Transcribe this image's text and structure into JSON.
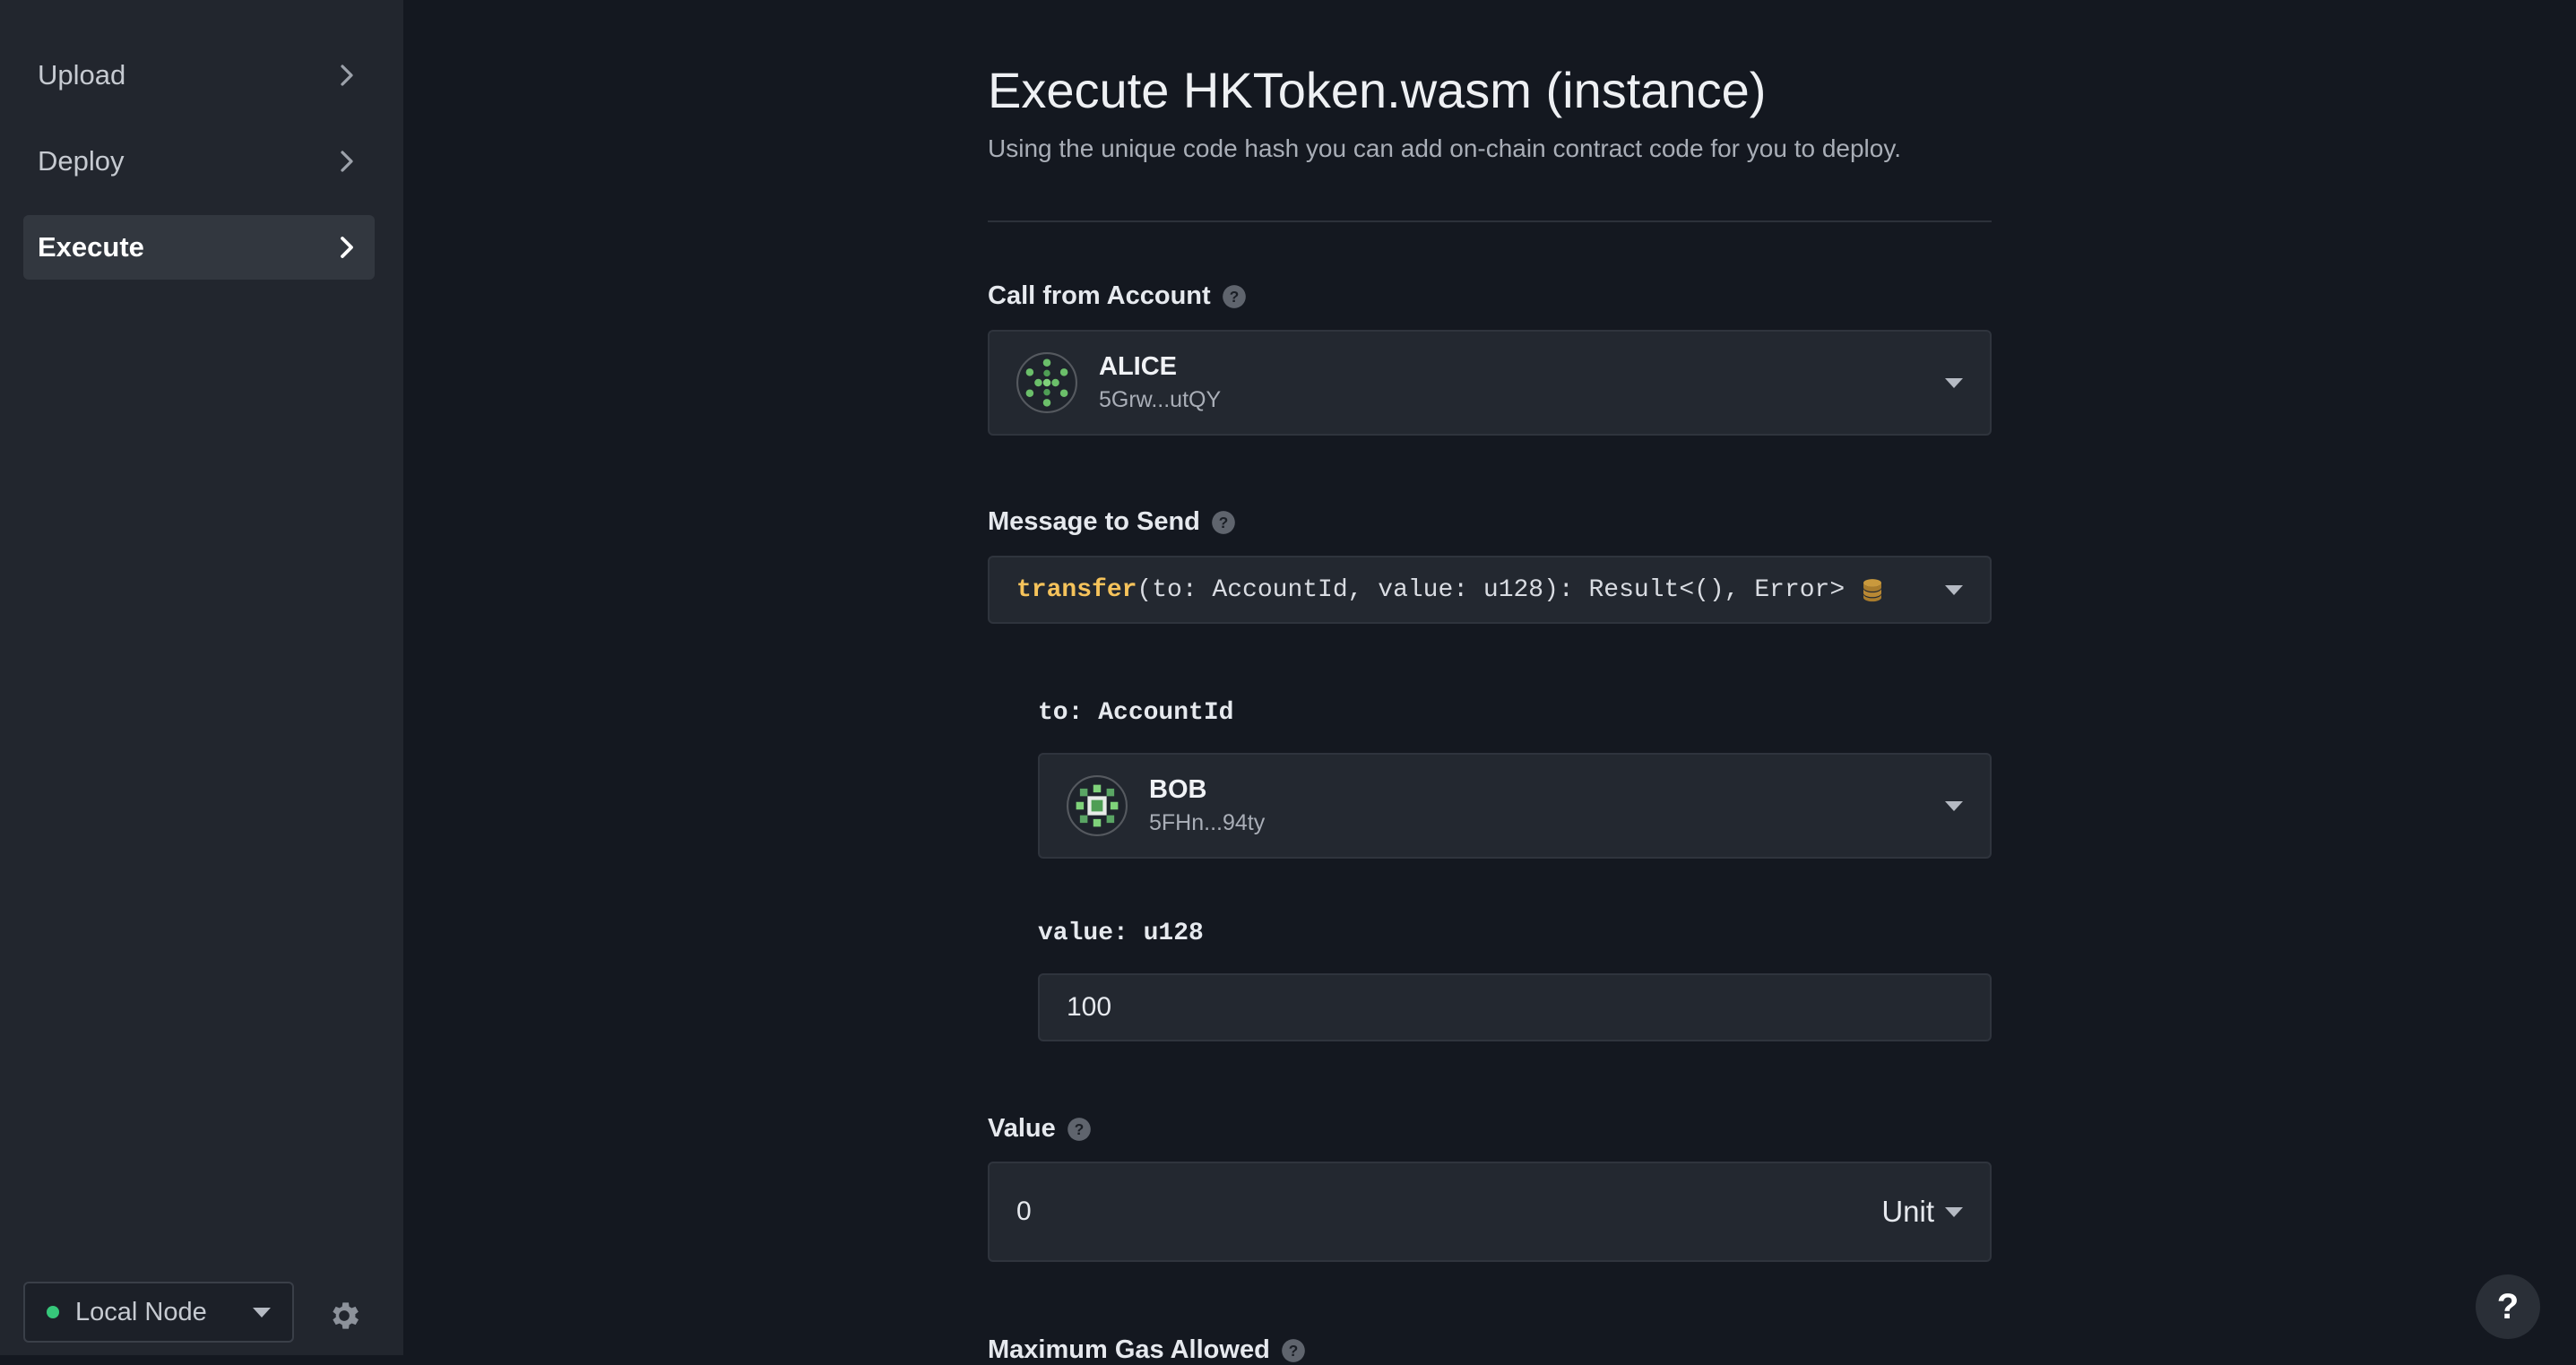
{
  "sidebar": {
    "items": [
      {
        "label": "Upload",
        "active": false
      },
      {
        "label": "Deploy",
        "active": false
      },
      {
        "label": "Execute",
        "active": true
      }
    ],
    "node": {
      "label": "Local Node",
      "status_color": "#36c77a"
    }
  },
  "main": {
    "title": "Execute HKToken.wasm (instance)",
    "subtitle": "Using the unique code hash you can add on-chain contract code for you to deploy.",
    "call_from": {
      "label": "Call from Account",
      "account_name": "ALICE",
      "account_address": "5Grw...utQY"
    },
    "message": {
      "label": "Message to Send",
      "fn_name": "transfer",
      "signature": "(to: AccountId, value: u128): Result<(), Error>"
    },
    "args": {
      "to_label": "to: AccountId",
      "to_name": "BOB",
      "to_address": "5FHn...94ty",
      "value_label": "value: u128",
      "value": "100"
    },
    "value_field": {
      "label": "Value",
      "value": "0",
      "unit": "Unit"
    },
    "gas": {
      "label": "Maximum Gas Allowed"
    }
  },
  "help_button": {
    "label": "?"
  },
  "colors": {
    "accent_yellow": "#f6c35b",
    "background": "#141820",
    "sidebar": "#22262e"
  }
}
